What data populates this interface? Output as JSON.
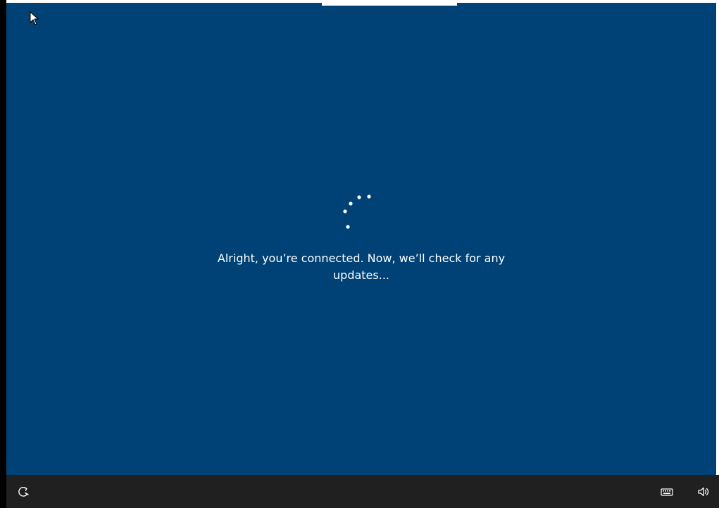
{
  "setup": {
    "message_line1": "Alright, you’re connected. Now, we’ll check for any",
    "message_line2": "updates..."
  },
  "icons": {
    "cursor": "mouse-pointer-icon",
    "spinner": "loading-spinner-icon",
    "ease_of_access": "ease-of-access-icon",
    "keyboard": "keyboard-icon",
    "volume": "volume-icon"
  },
  "colors": {
    "background": "#004275",
    "taskbar": "#202020",
    "text": "#ffffff"
  }
}
